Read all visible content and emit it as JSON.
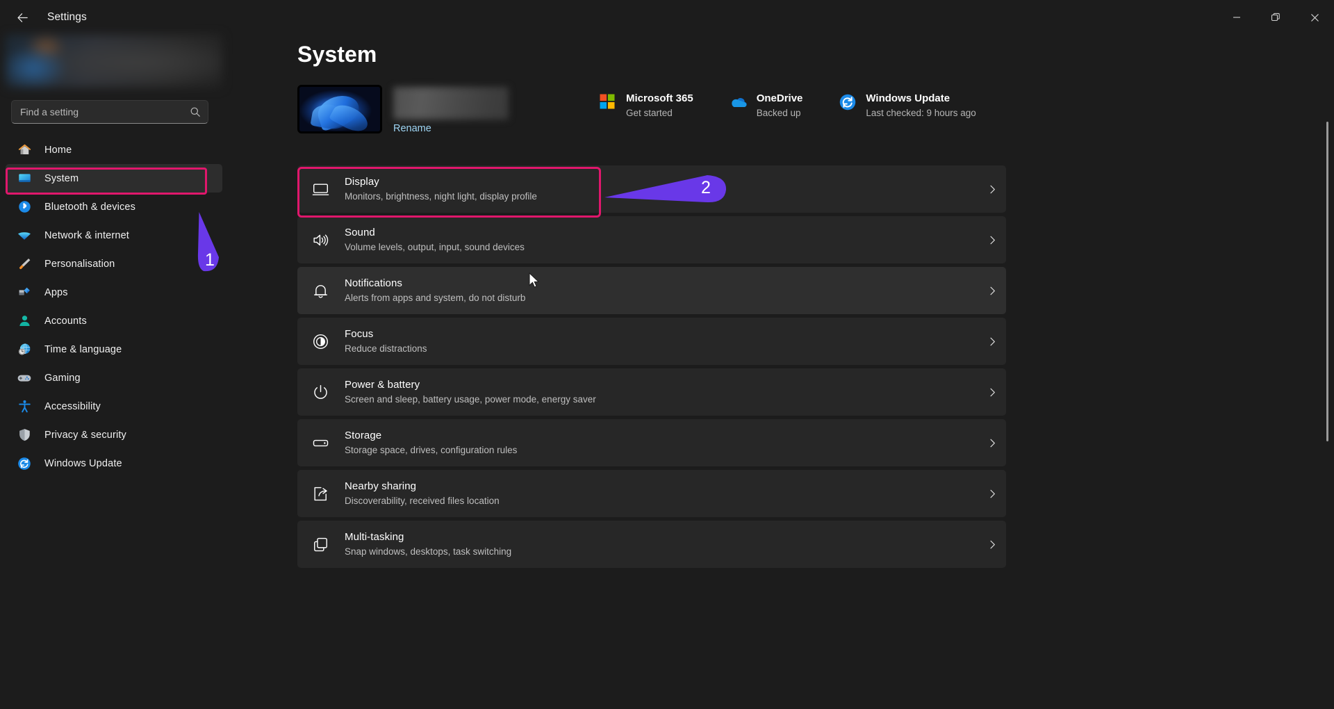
{
  "window": {
    "title": "Settings",
    "back_icon": "back-arrow-icon",
    "minimize_icon": "minimize-icon",
    "maximize_icon": "restore-icon",
    "close_icon": "close-icon"
  },
  "search": {
    "placeholder": "Find a setting",
    "value": "",
    "icon": "search-icon"
  },
  "sidebar": {
    "account_name": "",
    "items": [
      {
        "label": "Home",
        "icon": "home-icon",
        "active": false
      },
      {
        "label": "System",
        "icon": "system-icon",
        "active": true
      },
      {
        "label": "Bluetooth & devices",
        "icon": "bluetooth-icon",
        "active": false
      },
      {
        "label": "Network & internet",
        "icon": "wifi-icon",
        "active": false
      },
      {
        "label": "Personalisation",
        "icon": "brush-icon",
        "active": false
      },
      {
        "label": "Apps",
        "icon": "apps-icon",
        "active": false
      },
      {
        "label": "Accounts",
        "icon": "account-icon",
        "active": false
      },
      {
        "label": "Time & language",
        "icon": "clock-globe-icon",
        "active": false
      },
      {
        "label": "Gaming",
        "icon": "gamepad-icon",
        "active": false
      },
      {
        "label": "Accessibility",
        "icon": "accessibility-icon",
        "active": false
      },
      {
        "label": "Privacy & security",
        "icon": "shield-icon",
        "active": false
      },
      {
        "label": "Windows Update",
        "icon": "update-icon",
        "active": false
      }
    ]
  },
  "main": {
    "page_title": "System",
    "device": {
      "name": "",
      "rename_label": "Rename",
      "thumbnail_icon": "device-wallpaper-thumbnail"
    },
    "quick_links": [
      {
        "title": "Microsoft 365",
        "subtitle": "Get started",
        "icon": "microsoft-logo-icon"
      },
      {
        "title": "OneDrive",
        "subtitle": "Backed up",
        "icon": "onedrive-cloud-icon"
      },
      {
        "title": "Windows Update",
        "subtitle": "Last checked: 9 hours ago",
        "icon": "windows-update-icon"
      }
    ],
    "rows": [
      {
        "title": "Display",
        "subtitle": "Monitors, brightness, night light, display profile",
        "icon": "monitor-icon",
        "highlighted": true,
        "hovered": false
      },
      {
        "title": "Sound",
        "subtitle": "Volume levels, output, input, sound devices",
        "icon": "speaker-icon",
        "highlighted": false,
        "hovered": false
      },
      {
        "title": "Notifications",
        "subtitle": "Alerts from apps and system, do not disturb",
        "icon": "bell-icon",
        "highlighted": false,
        "hovered": true
      },
      {
        "title": "Focus",
        "subtitle": "Reduce distractions",
        "icon": "focus-icon",
        "highlighted": false,
        "hovered": false
      },
      {
        "title": "Power & battery",
        "subtitle": "Screen and sleep, battery usage, power mode, energy saver",
        "icon": "power-icon",
        "highlighted": false,
        "hovered": false
      },
      {
        "title": "Storage",
        "subtitle": "Storage space, drives, configuration rules",
        "icon": "storage-icon",
        "highlighted": false,
        "hovered": false
      },
      {
        "title": "Nearby sharing",
        "subtitle": "Discoverability, received files location",
        "icon": "nearby-share-icon",
        "highlighted": false,
        "hovered": false
      },
      {
        "title": "Multi-tasking",
        "subtitle": "Snap windows, desktops, task switching",
        "icon": "multitask-icon",
        "highlighted": false,
        "hovered": false
      }
    ]
  },
  "annotations": {
    "highlight_color": "#e0176c",
    "arrow_color": "#6938e8",
    "markers": [
      {
        "label": "1",
        "target": "sidebar-item-system"
      },
      {
        "label": "2",
        "target": "settings-row-display"
      }
    ]
  }
}
